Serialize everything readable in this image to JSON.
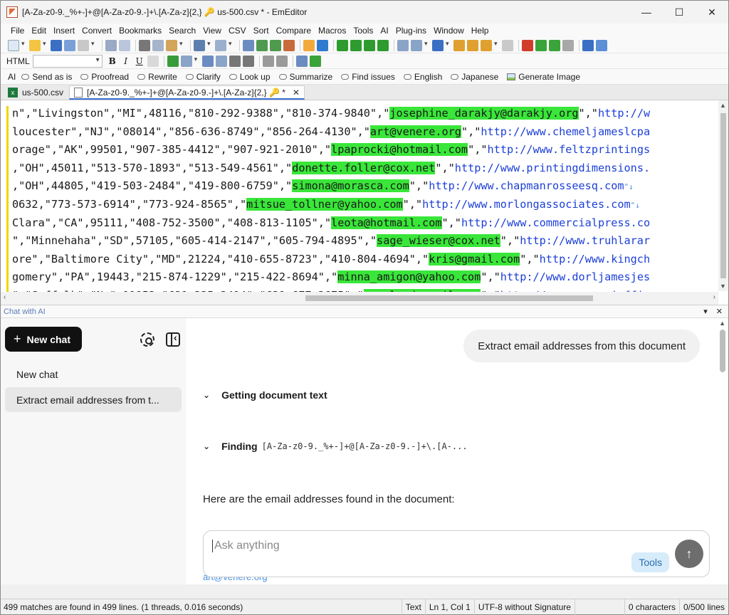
{
  "window": {
    "title": "[A-Za-z0-9._%+-]+@[A-Za-z0-9.-]+\\.[A-Za-z]{2,} 🔑 us-500.csv * - EmEditor",
    "minimize": "—",
    "maximize": "☐",
    "close": "✕"
  },
  "menu": [
    "File",
    "Edit",
    "Insert",
    "Convert",
    "Bookmarks",
    "Search",
    "View",
    "CSV",
    "Sort",
    "Compare",
    "Macros",
    "Tools",
    "AI",
    "Plug-ins",
    "Window",
    "Help"
  ],
  "format_bar": {
    "label": "HTML",
    "bold": "B",
    "italic": "I",
    "underline": "U"
  },
  "ai_bar": {
    "label": "AI",
    "items": [
      "Send as is",
      "Proofread",
      "Rewrite",
      "Clarify",
      "Look up",
      "Summarize",
      "Find issues",
      "English",
      "Japanese",
      "Generate Image"
    ]
  },
  "tabs": [
    {
      "label": "us-500.csv",
      "icon": "excel-icon"
    },
    {
      "label": "[A-Za-z0-9._%+-]+@[A-Za-z0-9.-]+\\.[A-Za-z]{2,} 🔑  *",
      "icon": "document-icon"
    }
  ],
  "editor": {
    "lines": [
      {
        "pre": "n\",\"Livingston\",\"MI\",48116,\"810-292-9388\",\"810-374-9840\",\"",
        "email": "josephine_darakjy@darakjy.org",
        "mid": "\",\"",
        "url": "http://w",
        "eol": ""
      },
      {
        "pre": "loucester\",\"NJ\",\"08014\",\"856-636-8749\",\"856-264-4130\",\"",
        "email": "art@venere.org",
        "mid": "\",\"",
        "url": "http://www.chemeljameslcpa",
        "eol": ""
      },
      {
        "pre": "orage\",\"AK\",99501,\"907-385-4412\",\"907-921-2010\",\"",
        "email": "lpaprocki@hotmail.com",
        "mid": "\",\"",
        "url": "http://www.feltzprintings",
        "eol": ""
      },
      {
        "pre": ",\"OH\",45011,\"513-570-1893\",\"513-549-4561\",\"",
        "email": "donette.foller@cox.net",
        "mid": "\",\"",
        "url": "http://www.printingdimensions.",
        "eol": ""
      },
      {
        "pre": ",\"OH\",44805,\"419-503-2484\",\"419-800-6759\",\"",
        "email": "simona@morasca.com",
        "mid": "\",\"",
        "url": "http://www.chapmanrosseesq.com",
        "eol": "\"↓"
      },
      {
        "pre": "0632,\"773-573-6914\",\"773-924-8565\",\"",
        "email": "mitsue_tollner@yahoo.com",
        "mid": "\",\"",
        "url": "http://www.morlongassociates.com",
        "eol": "\"↓"
      },
      {
        "pre": "Clara\",\"CA\",95111,\"408-752-3500\",\"408-813-1105\",\"",
        "email": "leota@hotmail.com",
        "mid": "\",\"",
        "url": "http://www.commercialpress.co",
        "eol": ""
      },
      {
        "pre": "\",\"Minnehaha\",\"SD\",57105,\"605-414-2147\",\"605-794-4895\",\"",
        "email": "sage_wieser@cox.net",
        "mid": "\",\"",
        "url": "http://www.truhlarar",
        "eol": ""
      },
      {
        "pre": "ore\",\"Baltimore City\",\"MD\",21224,\"410-655-8723\",\"410-804-4694\",\"",
        "email": "kris@gmail.com",
        "mid": "\",\"",
        "url": "http://www.kingch",
        "eol": ""
      },
      {
        "pre": "gomery\",\"PA\",19443,\"215-874-1229\",\"215-422-8694\",\"",
        "email": "minna_amigon@yahoo.com",
        "mid": "\",\"",
        "url": "http://www.dorljamesjes",
        "eol": ""
      },
      {
        "pre": "\",\"Suffolk\",\"Ny\",11953,\"631-335-3414\",\"631-677-3675\",\"",
        "email": "amaclead@gmail.com",
        "mid": "\",\"",
        "url": "http://www.rangonioffic",
        "eol": ""
      }
    ]
  },
  "chat_panel": {
    "title": "Chat with AI",
    "new_chat_button": "New chat",
    "history_heading": "New chat",
    "history_item": "Extract email addresses from t...",
    "user_message": "Extract email addresses from this document",
    "steps": [
      {
        "label": "Getting document text",
        "code": ""
      },
      {
        "label": "Finding",
        "code": "[A-Za-z0-9._%+-]+@[A-Za-z0-9.-]+\\.[A-..."
      }
    ],
    "answer": "Here are the email addresses found in the document:",
    "peek_text": "art@venere.org",
    "input_placeholder": "Ask anything",
    "tools_button": "Tools",
    "send_icon": "↑"
  },
  "status_bar": {
    "message": "499 matches are found in 499 lines. (1 threads, 0.016 seconds)",
    "mode": "Text",
    "position": "Ln 1, Col 1",
    "encoding": "UTF-8 without Signature",
    "chars": "0 characters",
    "lines": "0/500 lines"
  },
  "colors": {
    "highlight": "#39e639",
    "url": "#1c3fd8",
    "accent": "#3c6fd6"
  }
}
